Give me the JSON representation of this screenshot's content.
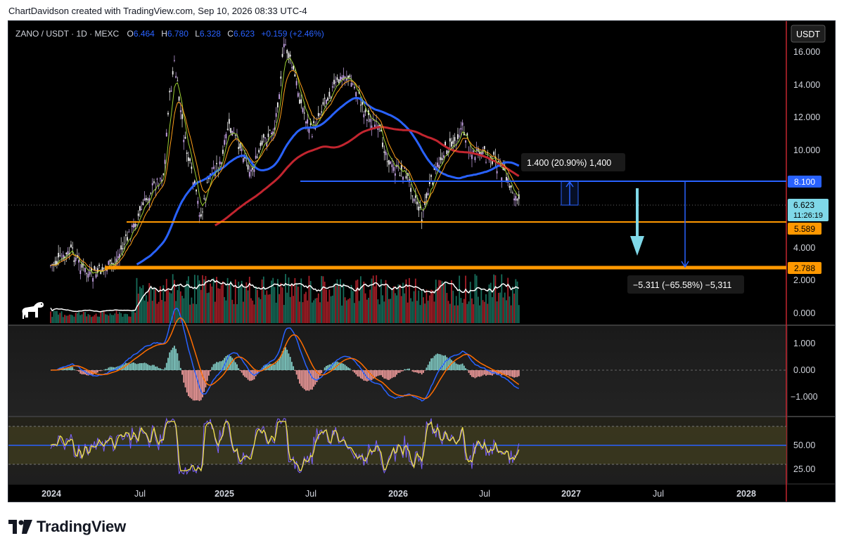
{
  "credit": "ChartDavidson created with TradingView.com, Sep 10, 2026 08:33 UTC-4",
  "header": {
    "symbol": "ZANO / USDT · 1D · MEXC",
    "o_label": "O",
    "o_value": "6.464",
    "h_label": "H",
    "h_value": "6.780",
    "l_label": "L",
    "l_value": "6.328",
    "c_label": "C",
    "c_value": "6.623",
    "change": "+0.159 (+2.46%)"
  },
  "currency_button": "USDT",
  "price_axis": [
    "16.000",
    "14.000",
    "12.000",
    "10.000",
    "4.000",
    "2.000",
    "0.000"
  ],
  "price_labels": {
    "resistance": "8.100",
    "current": "6.623",
    "countdown": "11:26:19",
    "support_mid": "5.589",
    "support_low": "2.788"
  },
  "measures": {
    "up": "1.400 (20.90%) 1,400",
    "down": "−5.311 (−65.58%) −5,311"
  },
  "macd_axis": [
    "1.000",
    "0.000",
    "−1.000"
  ],
  "rsi_axis": [
    "50.00",
    "25.00"
  ],
  "time_axis": [
    "2024",
    "Jul",
    "2025",
    "Jul",
    "2026",
    "Jul",
    "2027",
    "Jul",
    "2028"
  ],
  "logo_text": "TradingView",
  "colors": {
    "background": "#000000",
    "candle_up": "#c8a6e8",
    "candle_down": "#ffffff",
    "ema_fast": "#9acd32",
    "ema_mid": "#ff9f1a",
    "ma_blue": "#2962ff",
    "ma_red": "#c2252f",
    "horizontal_blue": "#2962ff",
    "horizontal_orange": "#ff9800",
    "arrow_cyan": "#7fd8e8",
    "volume_red": "#c2252f",
    "volume_green": "#1b7f6a",
    "rsi_line": "#f2e24a",
    "rsi_purple": "#7b61ff",
    "rsi_band": "#3d3b1f"
  }
}
